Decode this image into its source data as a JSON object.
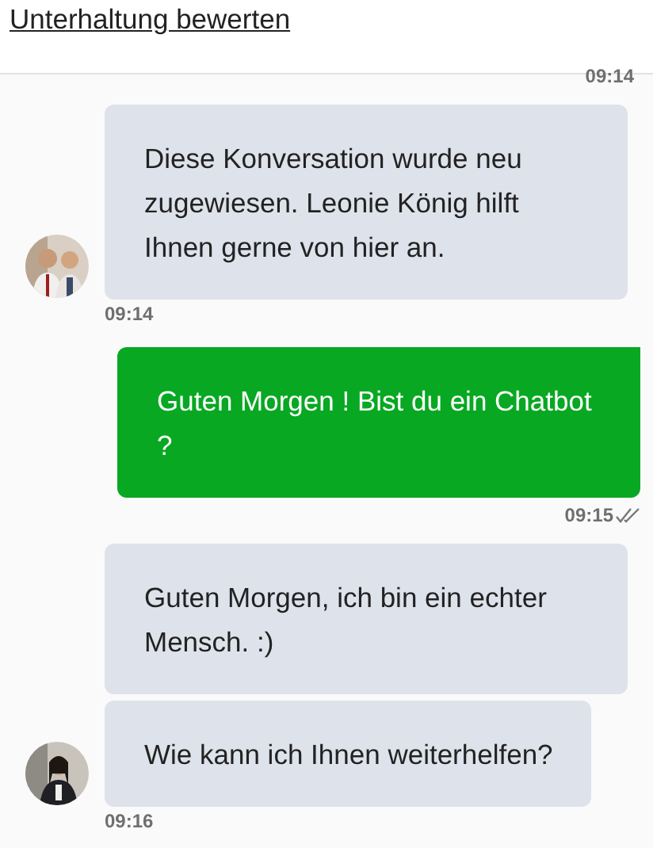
{
  "header": {
    "link": "Unterhaltung bewerten"
  },
  "top_time": "09:14",
  "messages": [
    {
      "kind": "agent",
      "bubbles": [
        "Diese Konversation wurde neu zugewiesen. Leonie König hilft Ihnen gerne von hier an."
      ],
      "time": "09:14"
    },
    {
      "kind": "user",
      "bubbles": [
        "Guten Morgen ! Bist du ein Chatbot ?"
      ],
      "time": "09:15",
      "read": true
    },
    {
      "kind": "agent",
      "bubbles": [
        "Guten Morgen, ich bin ein echter Mensch. :)",
        "Wie kann ich Ihnen weiterhelfen?"
      ],
      "time": "09:16"
    }
  ]
}
